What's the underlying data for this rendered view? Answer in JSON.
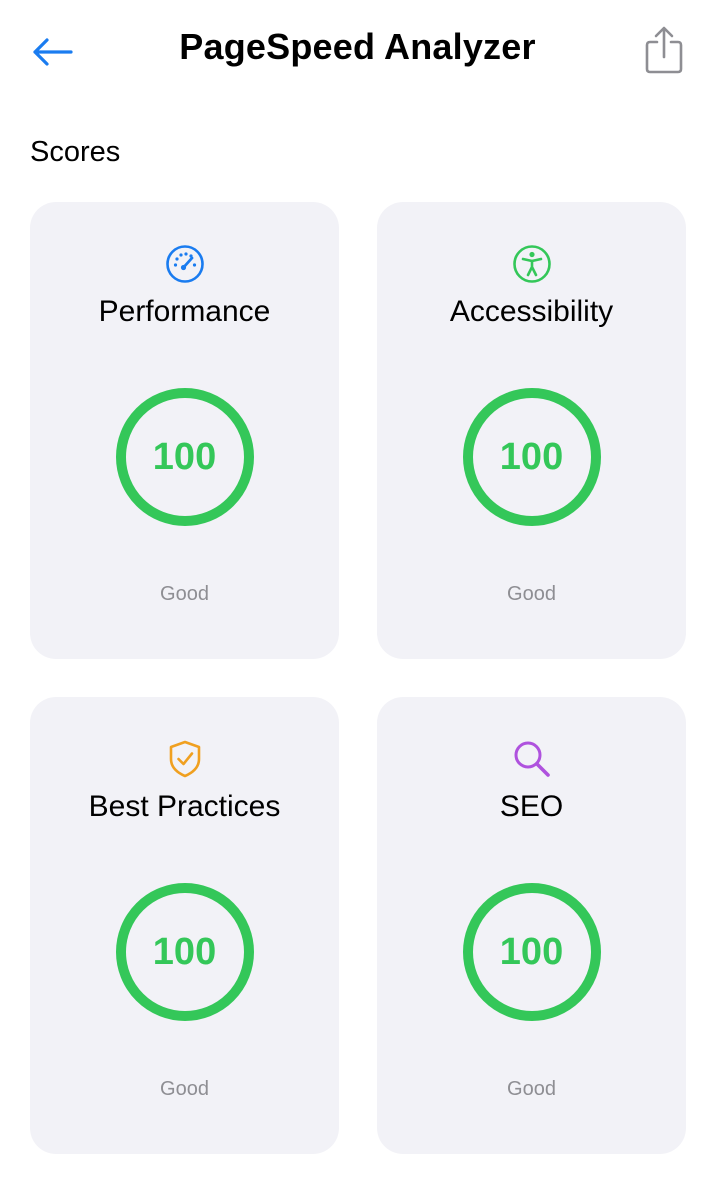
{
  "nav": {
    "title": "PageSpeed Analyzer",
    "back_icon": "arrow-left-icon",
    "share_icon": "share-icon"
  },
  "section": {
    "title": "Scores"
  },
  "colors": {
    "accent": "#1a7cf0",
    "good": "#34c759",
    "card_bg": "#f2f2f7",
    "performance_icon": "#1a7cf0",
    "accessibility_icon": "#34c759",
    "best_practices_icon": "#f0a020",
    "seo_icon": "#af52de"
  },
  "cards": [
    {
      "title": "Performance",
      "icon": "speedometer-icon",
      "score": "100",
      "status": "Good"
    },
    {
      "title": "Accessibility",
      "icon": "accessibility-icon",
      "score": "100",
      "status": "Good"
    },
    {
      "title": "Best Practices",
      "icon": "shield-check-icon",
      "score": "100",
      "status": "Good"
    },
    {
      "title": "SEO",
      "icon": "magnifying-glass-icon",
      "score": "100",
      "status": "Good"
    }
  ]
}
